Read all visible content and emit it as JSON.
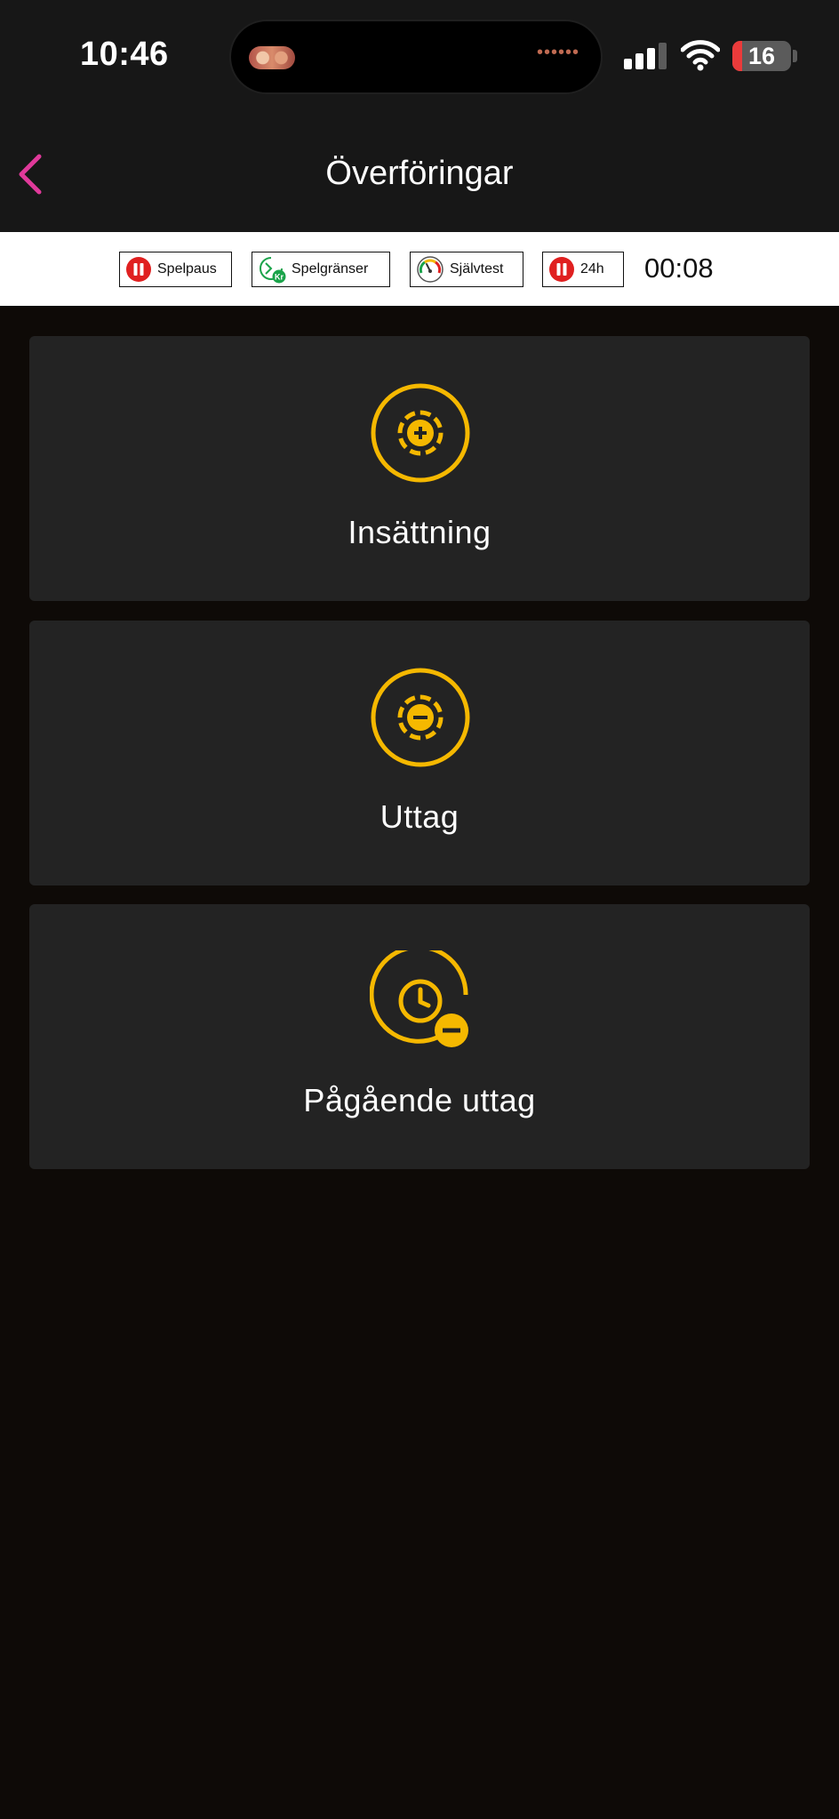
{
  "status_bar": {
    "time": "10:46",
    "battery_level": "16"
  },
  "header": {
    "title": "Överföringar"
  },
  "responsible_gaming": {
    "spelpaus": "Spelpaus",
    "spelgranser": "Spelgränser",
    "sjalvtest": "Självtest",
    "pause24": "24h",
    "timer": "00:08"
  },
  "cards": [
    {
      "label": "Insättning",
      "icon": "deposit-plus-icon"
    },
    {
      "label": "Uttag",
      "icon": "withdraw-minus-icon"
    },
    {
      "label": "Pågående uttag",
      "icon": "pending-withdrawal-clock-icon"
    }
  ],
  "colors": {
    "accent": "#f5b800",
    "back_arrow": "#e0399a",
    "card_bg": "#232323",
    "page_bg": "#0e0a07",
    "header_bg": "#171717",
    "pause_red": "#e02020",
    "limits_green": "#1aa34a"
  }
}
